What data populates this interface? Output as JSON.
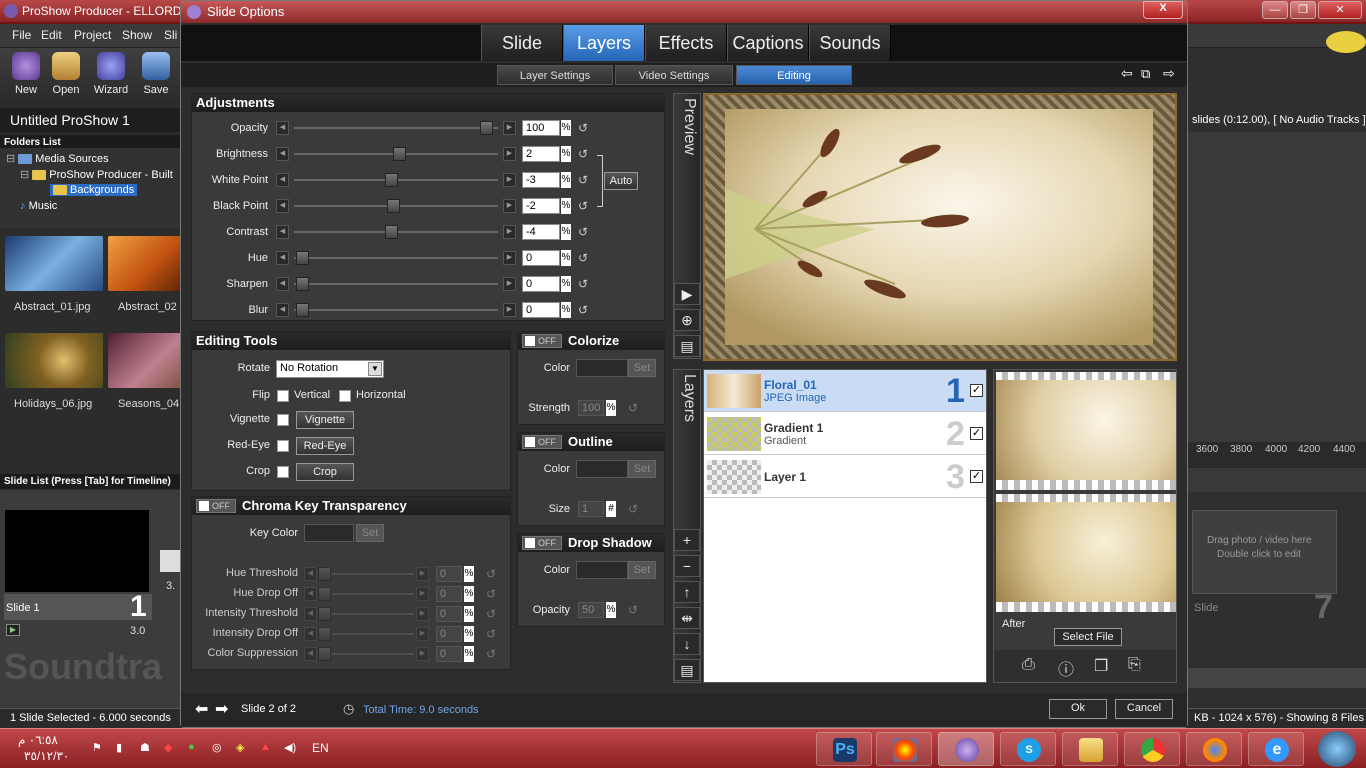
{
  "app": {
    "title": "ProShow Producer - ELLORD",
    "menu": [
      "File",
      "Edit",
      "Project",
      "Show",
      "Sli"
    ],
    "toolbar": [
      "New",
      "Open",
      "Wizard",
      "Save"
    ],
    "project_title": "Untitled ProShow 1",
    "folders_header": "Folders List",
    "tree": [
      "Media Sources",
      "ProShow Producer - Built",
      "Backgrounds",
      "Music"
    ],
    "thumbs": [
      "Abstract_01.jpg",
      "Abstract_02",
      "Holidays_06.jpg",
      "Seasons_04"
    ],
    "slide_list_header": "Slide List (Press [Tab] for Timeline)",
    "slide1_label": "Slide 1",
    "slide1_num": "1",
    "slide1_dur": "3.0",
    "slide2_dur": "3.",
    "soundtrack": "Soundtra",
    "status_left": "1 Slide Selected - 6.000 seconds",
    "right_info": "slides (0:12.00), [ No Audio Tracks ]",
    "timeline_ticks": [
      "3600",
      "3800",
      "4000",
      "4200",
      "4400"
    ],
    "drop_hint_1": "Drag photo / video here",
    "drop_hint_2": "Double click to edit",
    "empty_slide_label": "Slide",
    "empty_slide_num": "7",
    "status_right": "KB - 1024 x 576) - Showing 8 Files"
  },
  "dialog": {
    "title": "Slide Options",
    "close": "X",
    "main_tabs": [
      "Slide",
      "Layers",
      "Effects",
      "Captions",
      "Sounds"
    ],
    "active_main_tab": "Layers",
    "sub_tabs": [
      "Layer Settings",
      "Video Settings",
      "Editing"
    ],
    "active_sub_tab": "Editing",
    "adjustments": {
      "title": "Adjustments",
      "rows": [
        {
          "label": "Opacity",
          "value": "100",
          "unit": "%"
        },
        {
          "label": "Brightness",
          "value": "2",
          "unit": "%"
        },
        {
          "label": "White Point",
          "value": "-3",
          "unit": "%"
        },
        {
          "label": "Black Point",
          "value": "-2",
          "unit": "%"
        },
        {
          "label": "Contrast",
          "value": "-4",
          "unit": "%"
        },
        {
          "label": "Hue",
          "value": "0",
          "unit": "%"
        },
        {
          "label": "Sharpen",
          "value": "0",
          "unit": "%"
        },
        {
          "label": "Blur",
          "value": "0",
          "unit": "%"
        }
      ],
      "auto_label": "Auto"
    },
    "editing_tools": {
      "title": "Editing Tools",
      "rotate_label": "Rotate",
      "rotate_value": "No Rotation",
      "flip_label": "Flip",
      "vertical_label": "Vertical",
      "horizontal_label": "Horizontal",
      "vignette_label": "Vignette",
      "vignette_btn": "Vignette",
      "redeye_label": "Red-Eye",
      "redeye_btn": "Red-Eye",
      "crop_label": "Crop",
      "crop_btn": "Crop"
    },
    "chroma": {
      "title": "Chroma Key Transparency",
      "toggle": "OFF",
      "key_color_label": "Key Color",
      "set_label": "Set",
      "rows": [
        {
          "label": "Hue Threshold",
          "value": "0",
          "unit": "%"
        },
        {
          "label": "Hue Drop Off",
          "value": "0",
          "unit": "%"
        },
        {
          "label": "Intensity Threshold",
          "value": "0",
          "unit": "%"
        },
        {
          "label": "Intensity Drop Off",
          "value": "0",
          "unit": "%"
        },
        {
          "label": "Color Suppression",
          "value": "0",
          "unit": "%"
        }
      ]
    },
    "colorize": {
      "title": "Colorize",
      "toggle": "OFF",
      "color_label": "Color",
      "set_label": "Set",
      "strength_label": "Strength",
      "strength_value": "100",
      "unit": "%"
    },
    "outline": {
      "title": "Outline",
      "toggle": "OFF",
      "color_label": "Color",
      "set_label": "Set",
      "size_label": "Size",
      "size_value": "1",
      "unit": "#"
    },
    "drop_shadow": {
      "title": "Drop Shadow",
      "toggle": "OFF",
      "color_label": "Color",
      "set_label": "Set",
      "opacity_label": "Opacity",
      "opacity_value": "50",
      "unit": "%"
    },
    "preview_label": "Preview",
    "layers_label": "Layers",
    "layers": [
      {
        "name": "Floral_01",
        "type": "JPEG Image",
        "num": "1",
        "checked": "✓"
      },
      {
        "name": "Gradient 1",
        "type": "Gradient",
        "num": "2",
        "checked": "✓"
      },
      {
        "name": "Layer 1",
        "type": "",
        "num": "3",
        "checked": "✓"
      }
    ],
    "after_label": "After",
    "select_file": "Select File",
    "footer": {
      "slide_of": "Slide 2 of 2",
      "total_time": "Total Time: 9.0 seconds",
      "ok": "Ok",
      "cancel": "Cancel"
    }
  },
  "taskbar": {
    "clock_time": "٠٦:٥٨ م",
    "clock_date": "٣٥/١٢/٣٠",
    "lang": "EN"
  },
  "colors": {
    "accent": "#2b6cc4",
    "titlebar": "#a33a3a",
    "panel": "#3a3a3a"
  }
}
